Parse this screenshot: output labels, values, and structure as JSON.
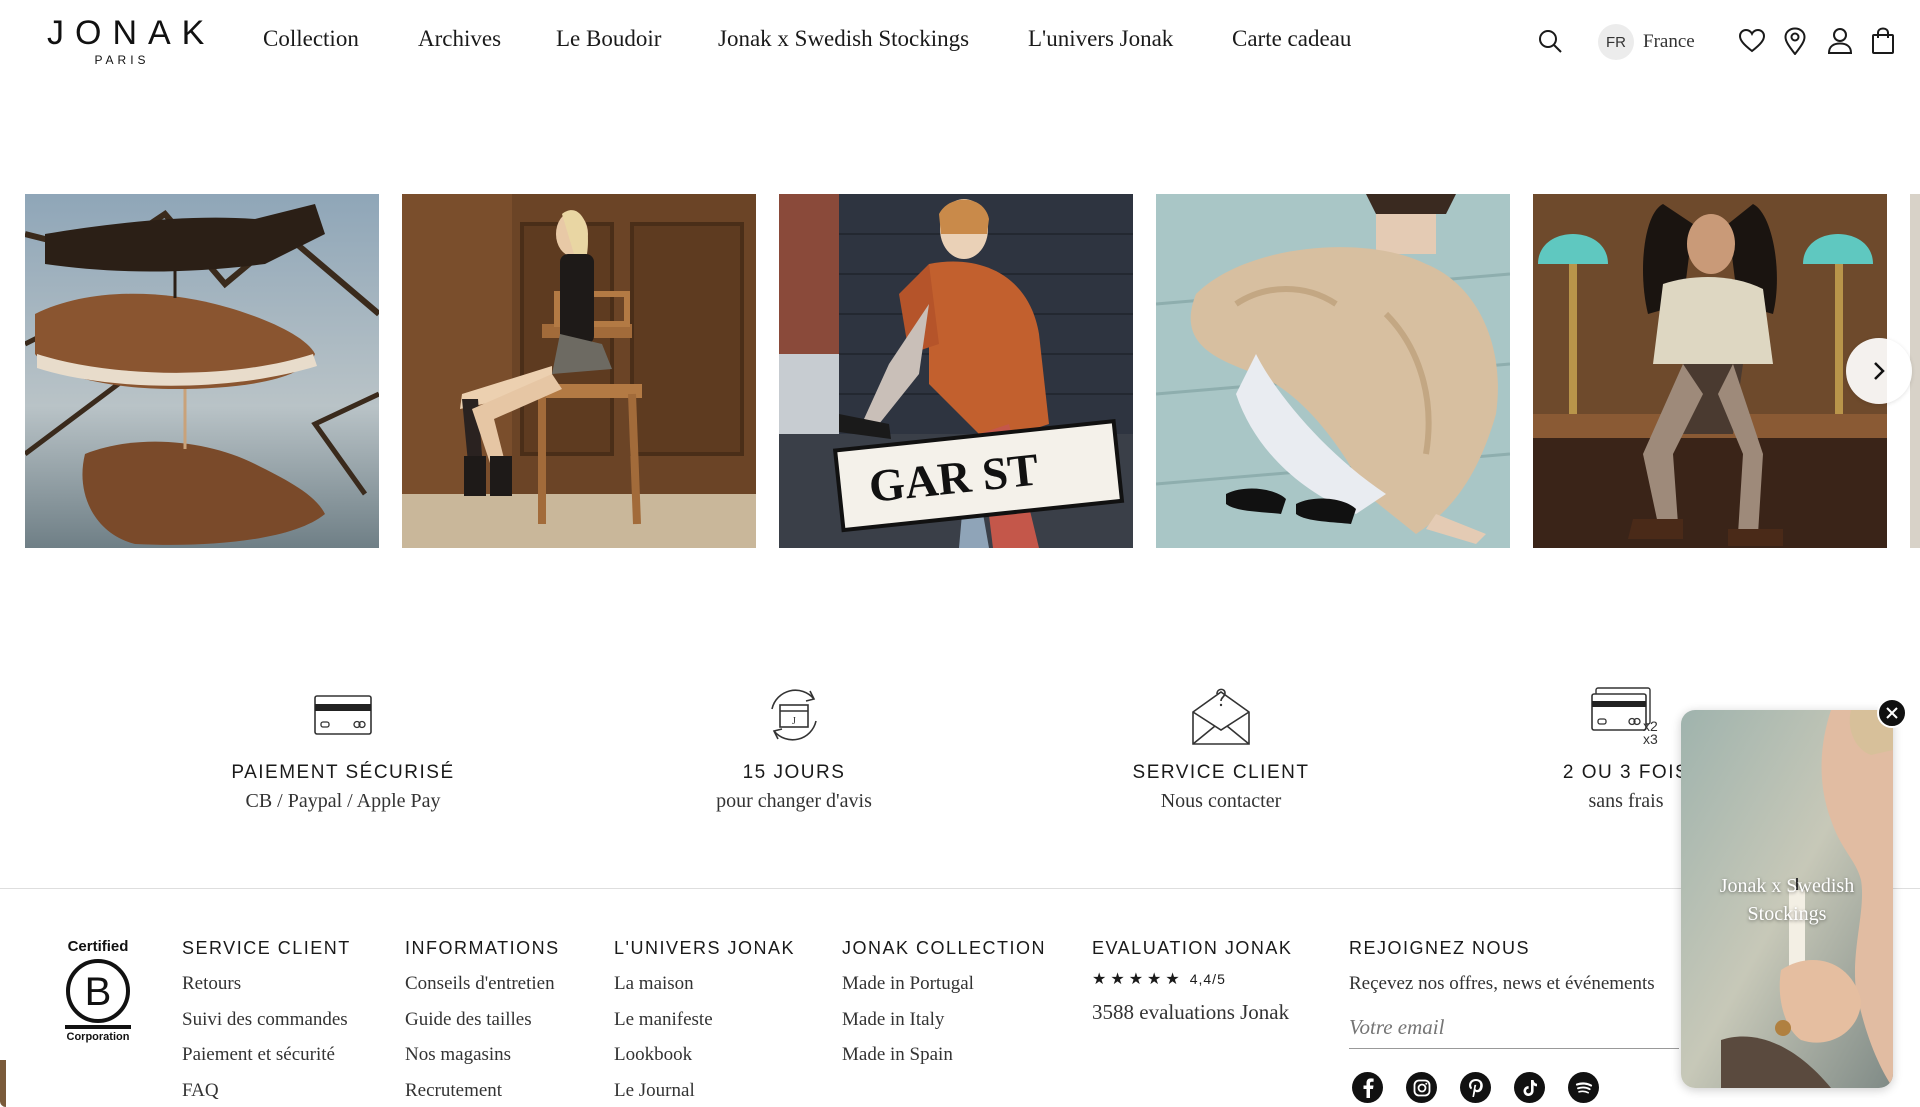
{
  "brand": {
    "name": "JONAK",
    "city": "PARIS"
  },
  "nav": {
    "items": [
      {
        "label": "Collection"
      },
      {
        "label": "Archives"
      },
      {
        "label": "Le Boudoir"
      },
      {
        "label": "Jonak x Swedish Stockings"
      },
      {
        "label": "L'univers Jonak"
      },
      {
        "label": "Carte cadeau"
      }
    ]
  },
  "header": {
    "search_icon": "search-icon",
    "lang_code": "FR",
    "country": "France",
    "icons": [
      "heart-icon",
      "location-pin-icon",
      "user-icon",
      "shopping-bag-icon"
    ]
  },
  "carousel": {
    "slides": [
      {
        "name": "slide-brown-sneakers-on-branch"
      },
      {
        "name": "slide-woman-seated-wood-chair"
      },
      {
        "name": "slide-woman-orange-coat-street-sign"
      },
      {
        "name": "slide-woman-fur-jacket-crouching"
      },
      {
        "name": "slide-woman-knee-socks-teal-lamps"
      }
    ],
    "sign_text": "GAR ST",
    "next_icon": "chevron-right-icon"
  },
  "features": [
    {
      "title": "PAIEMENT SÉCURISÉ",
      "subtitle": "CB / Paypal / Apple Pay",
      "icon": "credit-card-icon"
    },
    {
      "title": "15 JOURS",
      "subtitle": "pour changer d'avis",
      "icon": "return-box-icon"
    },
    {
      "title": "SERVICE CLIENT",
      "subtitle": "Nous contacter",
      "icon": "envelope-question-icon"
    },
    {
      "title": "2 OU 3 FOIS",
      "subtitle": "sans frais",
      "icon": "cards-installments-icon",
      "badge_top": "x2",
      "badge_bottom": "x3"
    }
  ],
  "footer": {
    "bcorp": {
      "top": "Certified",
      "letter": "B",
      "bottom": "Corporation"
    },
    "columns": [
      {
        "title": "SERVICE CLIENT",
        "links": [
          "Retours",
          "Suivi des commandes",
          "Paiement et sécurité",
          "FAQ"
        ]
      },
      {
        "title": "INFORMATIONS",
        "links": [
          "Conseils d'entretien",
          "Guide des tailles",
          "Nos magasins",
          "Recrutement"
        ]
      },
      {
        "title": "L'UNIVERS JONAK",
        "links": [
          "La maison",
          "Le manifeste",
          "Lookbook",
          "Le Journal"
        ]
      },
      {
        "title": "JONAK COLLECTION",
        "links": [
          "Made in Portugal",
          "Made in Italy",
          "Made in Spain"
        ]
      }
    ],
    "rating": {
      "title": "EVALUATION JONAK",
      "stars": "★★★★★",
      "score": "4,4/5",
      "count": "3588 evaluations Jonak"
    },
    "newsletter": {
      "title": "REJOIGNEZ NOUS",
      "subtitle": "Reçevez nos offres, news et événements",
      "placeholder": "Votre email"
    },
    "socials": [
      "facebook-icon",
      "instagram-icon",
      "pinterest-icon",
      "tiktok-icon",
      "spotify-icon"
    ]
  },
  "popup": {
    "text_line1": "Jonak x Swedish",
    "text_line2": "Stockings",
    "close_icon": "close-icon"
  }
}
